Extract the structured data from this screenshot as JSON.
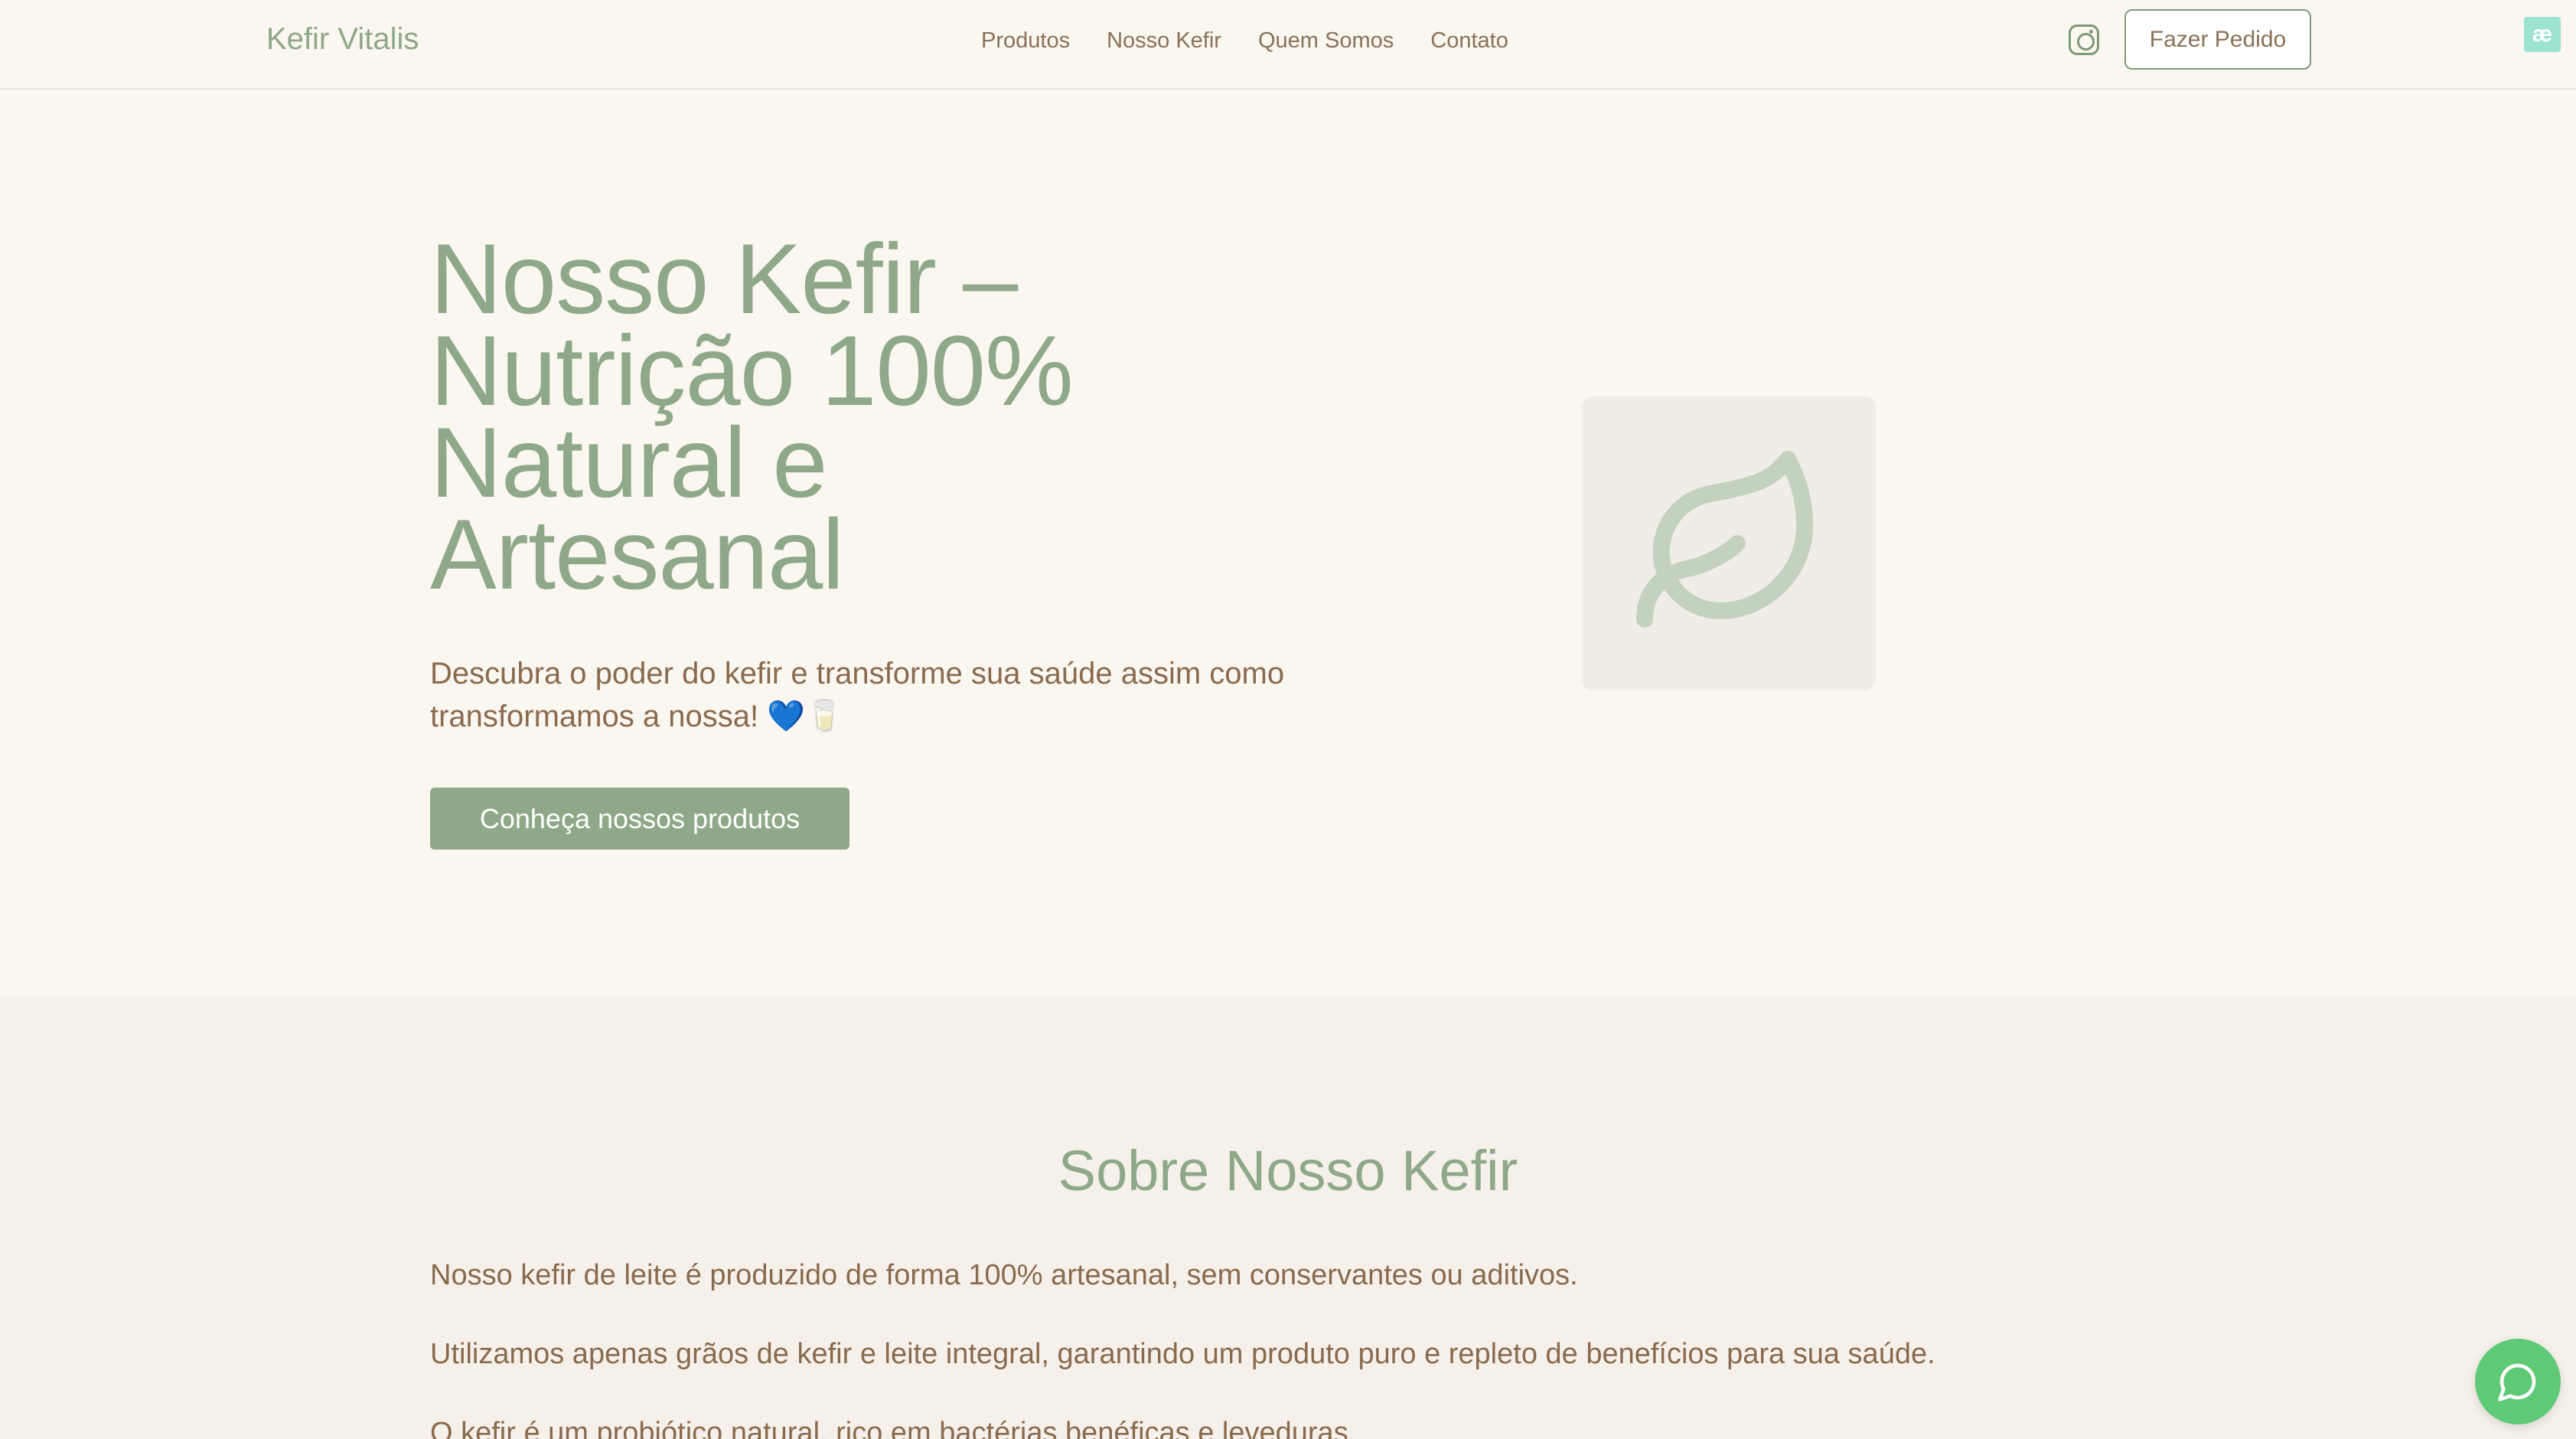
{
  "header": {
    "brand": "Kefir Vitalis",
    "nav": [
      "Produtos",
      "Nosso Kefir",
      "Quem Somos",
      "Contato"
    ],
    "order_button": "Fazer Pedido",
    "badge": "æ"
  },
  "hero": {
    "title": "Nosso Kefir – Nutrição 100% Natural e Artesanal",
    "subtitle": "Descubra o poder do kefir e transforme sua saúde assim como transformamos a nossa! 💙🥛",
    "cta": "Conheça nossos produtos"
  },
  "about": {
    "title": "Sobre Nosso Kefir",
    "paragraphs": [
      "Nosso kefir de leite é produzido de forma 100% artesanal, sem conservantes ou aditivos.",
      "Utilizamos apenas grãos de kefir e leite integral, garantindo um produto puro e repleto de benefícios para sua saúde.",
      "O kefir é um probiótico natural, rico em bactérias benéficas e leveduras."
    ]
  },
  "colors": {
    "background": "#faf6f0",
    "section_bg": "#f5f1ea",
    "brand_green": "#8fa888",
    "text_brown": "#8a6a4c",
    "chat_green": "#5ec977"
  },
  "icons": {
    "social": "instagram-icon",
    "hero_image": "leaf-icon",
    "chat": "chat-bubble-icon"
  }
}
